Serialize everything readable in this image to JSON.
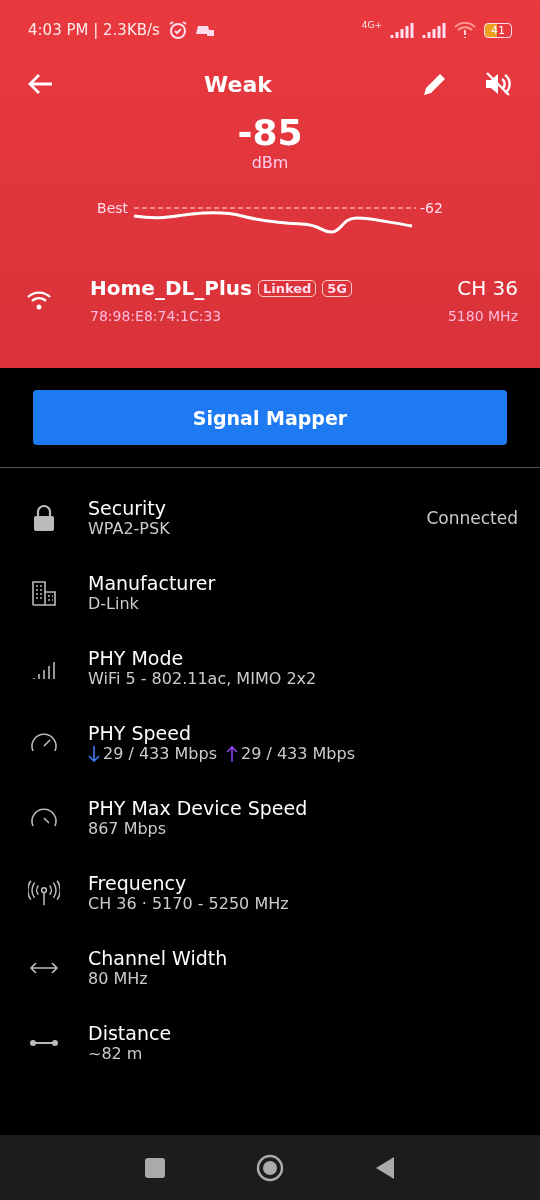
{
  "status_bar": {
    "time": "4:03 PM | 2.3KB/s",
    "network_type": "4G+",
    "battery": "41"
  },
  "toolbar": {
    "title": "Weak"
  },
  "signal": {
    "value": "-85",
    "unit": "dBm",
    "best_label": "Best",
    "best_value": "-62"
  },
  "network": {
    "ssid": "Home_DL_Plus",
    "badges": [
      "Linked",
      "5G"
    ],
    "bssid": "78:98:E8:74:1C:33",
    "channel": "CH 36",
    "frequency": "5180 MHz"
  },
  "action_button": "Signal Mapper",
  "details": [
    {
      "kind": "text",
      "label": "Security",
      "value": "WPA2-PSK",
      "status": "Connected"
    },
    {
      "kind": "text",
      "label": "Manufacturer",
      "value": "D-Link"
    },
    {
      "kind": "text",
      "label": "PHY Mode",
      "value": "WiFi 5 - 802.11ac, MIMO 2x2"
    },
    {
      "kind": "speed",
      "label": "PHY Speed",
      "down": "29 / 433 Mbps",
      "up": "29 / 433 Mbps"
    },
    {
      "kind": "text",
      "label": "PHY Max Device Speed",
      "value": "867 Mbps"
    },
    {
      "kind": "text",
      "label": "Frequency",
      "value": "CH 36 · 5170 - 5250 MHz"
    },
    {
      "kind": "text",
      "label": "Channel Width",
      "value": "80 MHz"
    },
    {
      "kind": "text",
      "label": "Distance",
      "value": "~82 m"
    }
  ]
}
